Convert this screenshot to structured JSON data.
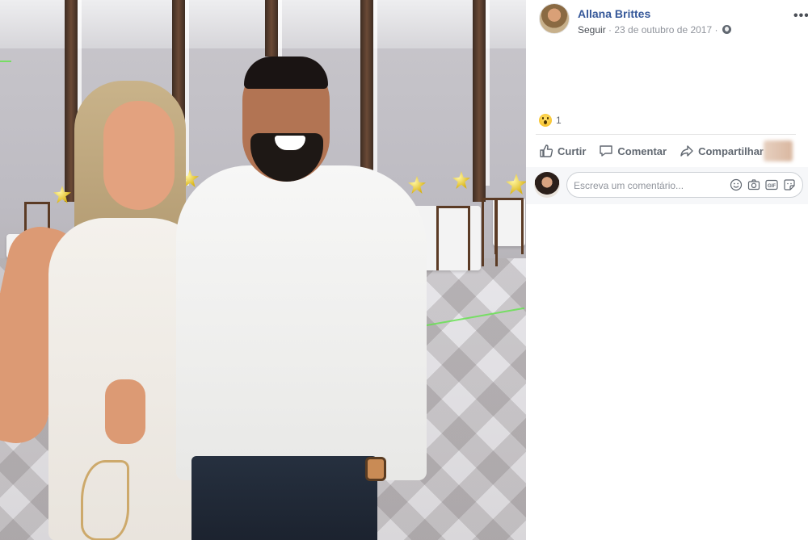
{
  "post": {
    "author": "Allana Brittes",
    "follow_label": "Seguir",
    "separator": "·",
    "date": "23 de outubro de 2017",
    "date_suffix": "·",
    "more_label": "•••"
  },
  "reactions": {
    "icon": "wow-icon",
    "count": "1"
  },
  "actions": [
    {
      "label": "Curtir",
      "icon": "thumbs-up-icon"
    },
    {
      "label": "Comentar",
      "icon": "comment-icon"
    },
    {
      "label": "Compartilhar",
      "icon": "share-icon"
    }
  ],
  "comment": {
    "placeholder": "Escreva um comentário..."
  },
  "colors": {
    "link": "#365899",
    "muted": "#90949c",
    "action": "#606770",
    "comment_bg": "#f6f7f9"
  }
}
